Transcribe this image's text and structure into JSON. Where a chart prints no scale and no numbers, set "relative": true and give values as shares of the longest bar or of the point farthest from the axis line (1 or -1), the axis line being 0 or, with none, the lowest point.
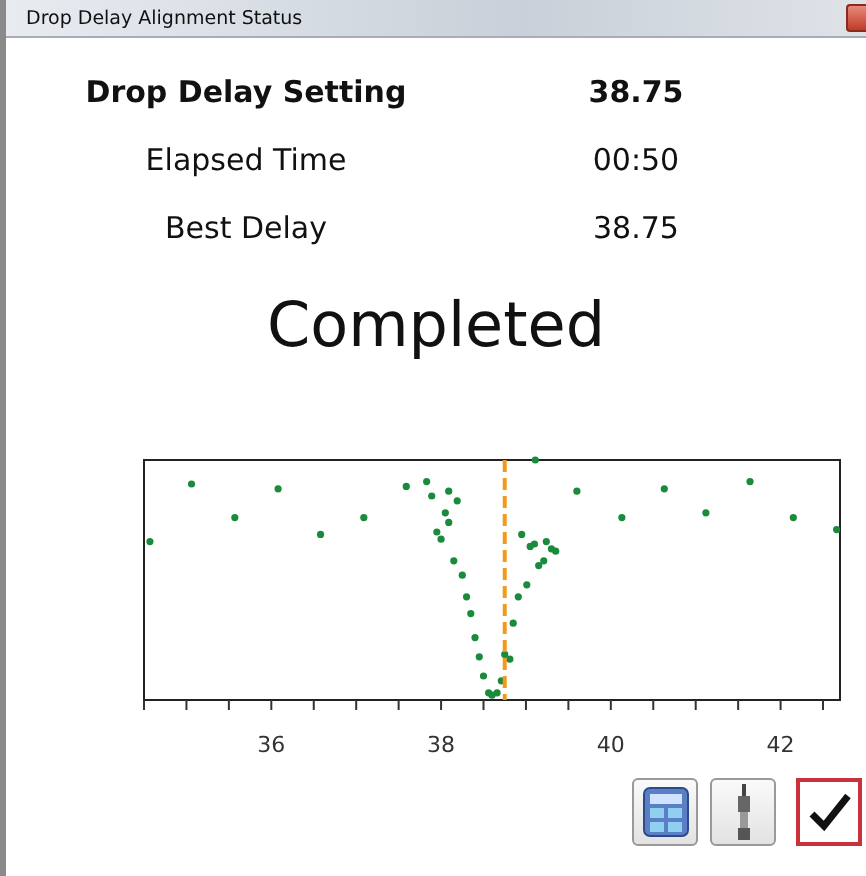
{
  "window": {
    "title": "Drop Delay Alignment Status"
  },
  "rows": [
    {
      "label": "Drop Delay Setting",
      "value": "38.75",
      "emphasis": true
    },
    {
      "label": "Elapsed Time",
      "value": "00:50",
      "emphasis": false
    },
    {
      "label": "Best Delay",
      "value": "38.75",
      "emphasis": false
    }
  ],
  "status": "Completed",
  "chart_data": {
    "type": "scatter",
    "xlim": [
      34.5,
      42.7
    ],
    "ylim": [
      0,
      1
    ],
    "relative": true,
    "xticks": [
      36,
      38,
      40,
      42
    ],
    "series": [
      {
        "color": "#1a8a3c",
        "x": [
          34.57,
          35.06,
          35.57,
          36.08,
          36.58,
          37.09,
          37.59,
          37.83,
          37.89,
          38.09,
          38.19,
          38.05,
          38.09,
          37.95,
          38.0,
          38.15,
          38.25,
          38.3,
          38.35,
          38.4,
          38.45,
          38.5,
          38.56,
          38.6,
          38.66,
          38.71,
          38.75,
          38.81,
          38.85,
          38.91,
          39.01,
          39.15,
          39.21,
          39.35,
          39.3,
          39.24,
          39.1,
          39.05,
          38.95,
          39.11,
          39.6,
          40.13,
          40.63,
          41.12,
          41.64,
          42.15,
          42.66
        ],
        "values": [
          0.66,
          0.9,
          0.76,
          0.88,
          0.69,
          0.76,
          0.89,
          0.91,
          0.85,
          0.87,
          0.83,
          0.78,
          0.74,
          0.7,
          0.67,
          0.58,
          0.52,
          0.43,
          0.36,
          0.26,
          0.18,
          0.1,
          0.03,
          0.02,
          0.03,
          0.08,
          0.19,
          0.17,
          0.32,
          0.43,
          0.48,
          0.56,
          0.58,
          0.62,
          0.63,
          0.66,
          0.65,
          0.64,
          0.69,
          1.0,
          0.87,
          0.76,
          0.88,
          0.78,
          0.91,
          0.76,
          0.71
        ]
      }
    ],
    "ref_lines": [
      {
        "axis": "x",
        "value": 38.75,
        "color": "#f39a1e"
      }
    ]
  },
  "buttons": [
    {
      "kind": "calculator",
      "focused": false
    },
    {
      "kind": "probe",
      "focused": false
    },
    {
      "kind": "confirm",
      "focused": true
    }
  ]
}
